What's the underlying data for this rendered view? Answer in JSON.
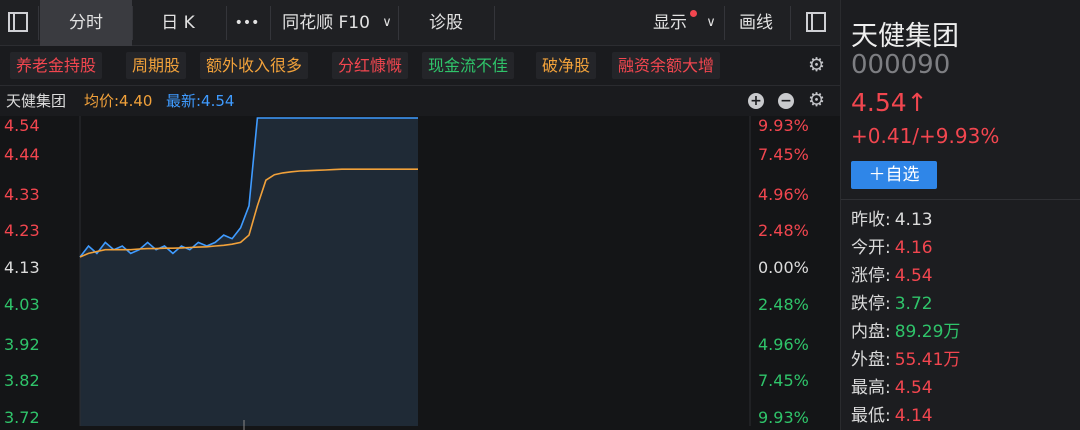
{
  "toolbar": {
    "tab_fenshi": "分时",
    "tab_rik": "日 K",
    "more": "•••",
    "f10": "同花顺 F10",
    "diagnose": "诊股",
    "display": "显示",
    "draw": "画线"
  },
  "tags": [
    {
      "label": "养老金持股",
      "color": "#f2464f"
    },
    {
      "label": "周期股",
      "color": "#f1a13a"
    },
    {
      "label": "额外收入很多",
      "color": "#f1a13a"
    },
    {
      "label": "分红慷慨",
      "color": "#f2464f"
    },
    {
      "label": "现金流不佳",
      "color": "#2fc46a"
    },
    {
      "label": "破净股",
      "color": "#f1a13a"
    },
    {
      "label": "融资余额大增",
      "color": "#f2464f"
    }
  ],
  "info": {
    "name": "天健集团",
    "avg": "均价:4.40",
    "latest": "最新:4.54"
  },
  "chart_data": {
    "type": "line",
    "prev_close": 4.13,
    "ylim": [
      3.72,
      4.54
    ],
    "left_ticks": [
      "4.54",
      "4.44",
      "4.33",
      "4.23",
      "4.13",
      "4.03",
      "3.92",
      "3.82",
      "3.72"
    ],
    "right_ticks": [
      "9.93%",
      "7.45%",
      "4.96%",
      "2.48%",
      "0.00%",
      "2.48%",
      "4.96%",
      "7.45%",
      "9.93%"
    ],
    "series": [
      {
        "color": "#3f9bff",
        "values": [
          4.16,
          4.19,
          4.17,
          4.2,
          4.18,
          4.19,
          4.17,
          4.18,
          4.2,
          4.18,
          4.19,
          4.17,
          4.19,
          4.18,
          4.2,
          4.19,
          4.2,
          4.22,
          4.21,
          4.24,
          4.3,
          4.54,
          4.54,
          4.54,
          4.54,
          4.54,
          4.54,
          4.54,
          4.54,
          4.54,
          4.54,
          4.54,
          4.54,
          4.54,
          4.54,
          4.54,
          4.54,
          4.54,
          4.54,
          4.54,
          4.54
        ]
      },
      {
        "color": "#f1a13a",
        "values": [
          4.16,
          4.17,
          4.175,
          4.18,
          4.18,
          4.18,
          4.18,
          4.182,
          4.183,
          4.183,
          4.184,
          4.184,
          4.185,
          4.186,
          4.187,
          4.188,
          4.19,
          4.192,
          4.195,
          4.2,
          4.22,
          4.3,
          4.37,
          4.385,
          4.39,
          4.393,
          4.395,
          4.396,
          4.397,
          4.398,
          4.399,
          4.4,
          4.4,
          4.4,
          4.4,
          4.4,
          4.4,
          4.4,
          4.4,
          4.4,
          4.4
        ]
      }
    ]
  },
  "panel": {
    "name": "天健集团",
    "code": "000090",
    "price": "4.54↑",
    "change": "+0.41/+9.93%",
    "add_watch": "＋自选",
    "stats": [
      {
        "label": "昨收:",
        "value": "4.13",
        "color": "white"
      },
      {
        "label": "今开:",
        "value": "4.16",
        "color": "red"
      },
      {
        "label": "涨停:",
        "value": "4.54",
        "color": "red"
      },
      {
        "label": "跌停:",
        "value": "3.72",
        "color": "green"
      },
      {
        "label": "内盘:",
        "value": "89.29万",
        "color": "green"
      },
      {
        "label": "外盘:",
        "value": "55.41万",
        "color": "red"
      },
      {
        "label": "最高:",
        "value": "4.54",
        "color": "red"
      },
      {
        "label": "最低:",
        "value": "4.14",
        "color": "red"
      }
    ]
  },
  "colors": {
    "up": "#f2464f",
    "down": "#2fc46a",
    "accent": "#2f86e8"
  }
}
